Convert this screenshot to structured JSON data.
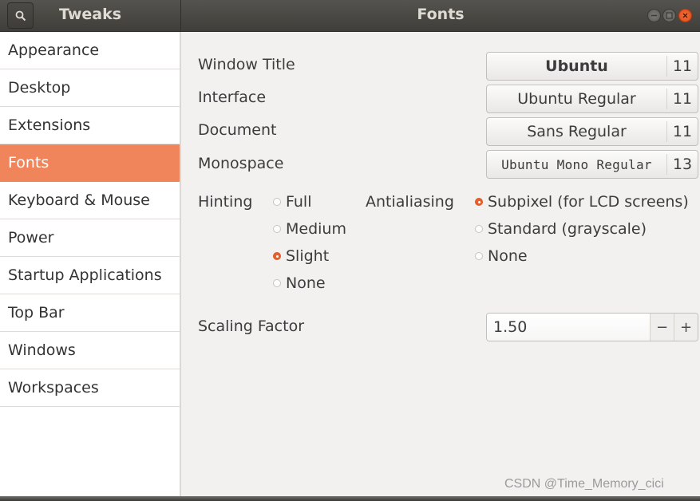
{
  "window": {
    "app_title": "Tweaks",
    "page_title": "Fonts",
    "controls": [
      "minimize",
      "maximize",
      "close"
    ]
  },
  "sidebar": {
    "items": [
      {
        "label": "Appearance",
        "active": false
      },
      {
        "label": "Desktop",
        "active": false
      },
      {
        "label": "Extensions",
        "active": false
      },
      {
        "label": "Fonts",
        "active": true
      },
      {
        "label": "Keyboard & Mouse",
        "active": false
      },
      {
        "label": "Power",
        "active": false
      },
      {
        "label": "Startup Applications",
        "active": false
      },
      {
        "label": "Top Bar",
        "active": false
      },
      {
        "label": "Windows",
        "active": false
      },
      {
        "label": "Workspaces",
        "active": false
      }
    ]
  },
  "fonts": {
    "window_title": {
      "label": "Window Title",
      "font": "Ubuntu",
      "size": "11"
    },
    "interface": {
      "label": "Interface",
      "font": "Ubuntu Regular",
      "size": "11"
    },
    "document": {
      "label": "Document",
      "font": "Sans Regular",
      "size": "11"
    },
    "monospace": {
      "label": "Monospace",
      "font": "Ubuntu Mono Regular",
      "size": "13"
    }
  },
  "hinting": {
    "label": "Hinting",
    "options": [
      "Full",
      "Medium",
      "Slight",
      "None"
    ],
    "selected": "Slight"
  },
  "antialiasing": {
    "label": "Antialiasing",
    "options": [
      "Subpixel (for LCD screens)",
      "Standard (grayscale)",
      "None"
    ],
    "selected": "Subpixel (for LCD screens)"
  },
  "scaling": {
    "label": "Scaling Factor",
    "value": "1.50",
    "decrement": "−",
    "increment": "+"
  },
  "colors": {
    "accent": "#f0845a",
    "radio_checked": "#e9602c",
    "close_button": "#dd4814",
    "titlebar": "#45433f"
  },
  "watermark": "CSDN @Time_Memory_cici"
}
